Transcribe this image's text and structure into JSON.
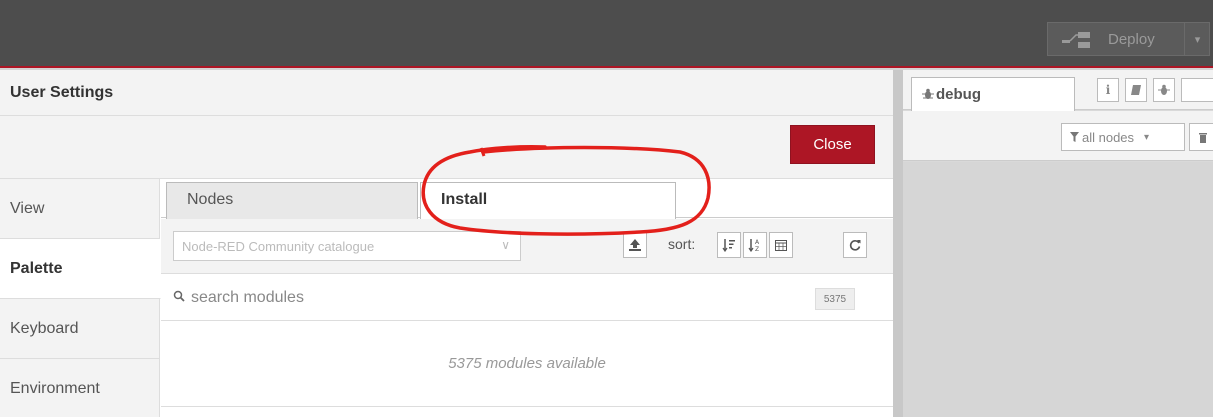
{
  "header": {
    "deploy_label": "Deploy",
    "deploy_caret": "▾"
  },
  "dialog": {
    "title": "User Settings",
    "close_label": "Close",
    "side_tabs": [
      "View",
      "Palette",
      "Keyboard",
      "Environment"
    ],
    "active_side_tab": "Palette",
    "tabs": [
      "Nodes",
      "Install"
    ],
    "active_tab": "Install",
    "catalogue": "Node-RED Community catalogue",
    "catalogue_caret": "∨",
    "sort_label": "sort:",
    "search_placeholder": "search modules",
    "module_count": "5375",
    "modules_available": "5375 modules available"
  },
  "sidebar": {
    "debug_tab": "debug",
    "info_icon": "i",
    "filter_label": "all nodes",
    "filter_caret": "▾"
  },
  "icons": {
    "upload": "upload-icon",
    "sort_alpha": "sort-alpha-icon",
    "sort_numeric": "sort-numeric-icon",
    "calendar": "calendar-icon",
    "refresh": "refresh-icon",
    "search": "search-icon",
    "bug": "bug-icon",
    "book": "book-icon",
    "filter": "filter-icon",
    "trash": "trash-icon"
  },
  "colors": {
    "accent": "#ad1625",
    "header_bg": "#4d4d4d",
    "annotation": "#e3201b"
  }
}
